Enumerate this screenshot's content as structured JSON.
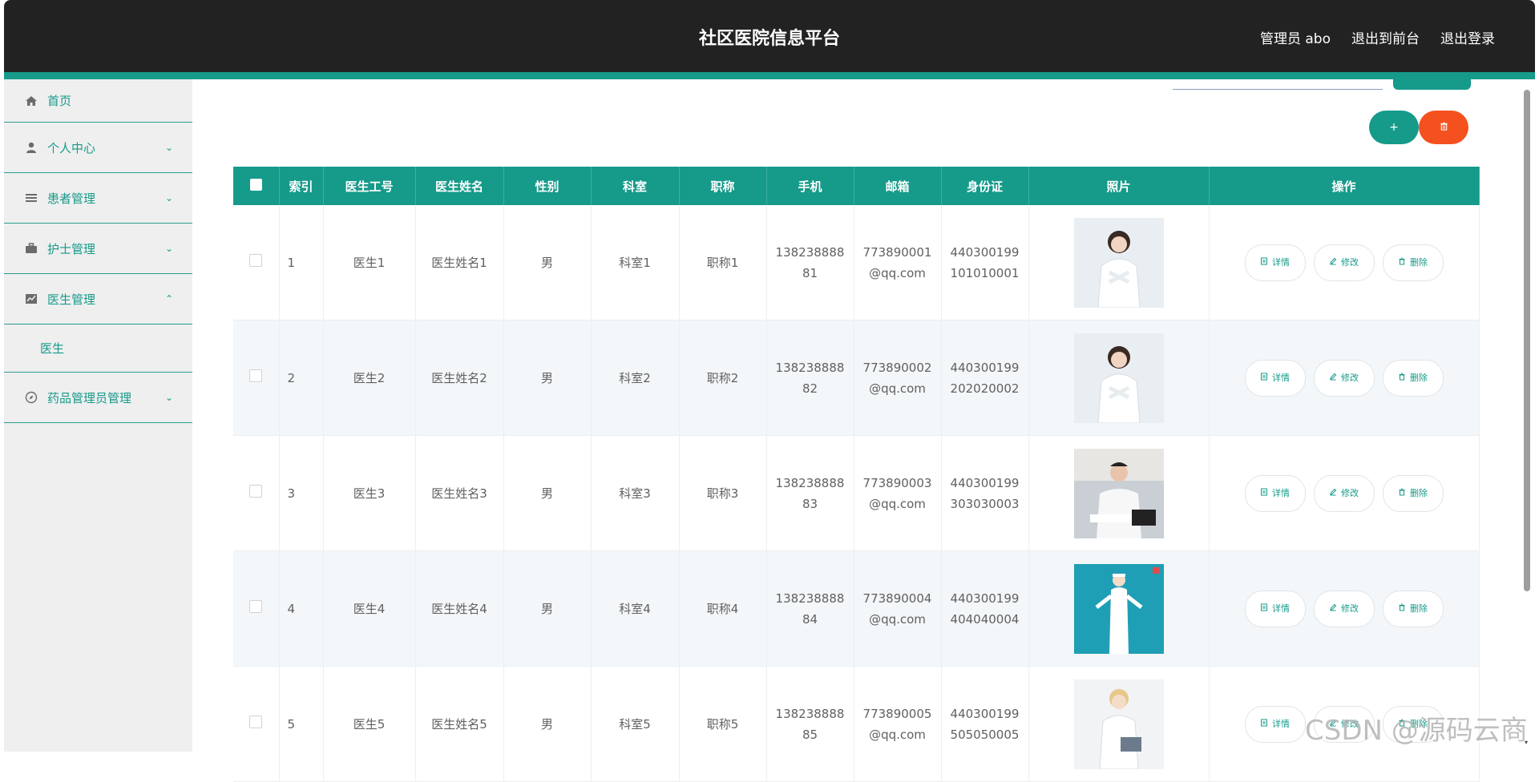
{
  "header": {
    "title": "社区医院信息平台",
    "user": "管理员 abo",
    "to_front": "退出到前台",
    "logout": "退出登录"
  },
  "sidebar": {
    "items": [
      {
        "label": "首页",
        "icon": "home-icon"
      },
      {
        "label": "个人中心",
        "icon": "user-icon",
        "expandable": true
      },
      {
        "label": "患者管理",
        "icon": "list-icon",
        "expandable": true
      },
      {
        "label": "护士管理",
        "icon": "briefcase-icon",
        "expandable": true
      },
      {
        "label": "医生管理",
        "icon": "chart-icon",
        "expanded": true
      },
      {
        "label": "药品管理员管理",
        "icon": "compass-icon",
        "expandable": true
      }
    ],
    "sub_item": "医生"
  },
  "toolbar": {
    "add_label": "+"
  },
  "table": {
    "headers": [
      "索引",
      "医生工号",
      "医生姓名",
      "性别",
      "科室",
      "职称",
      "手机",
      "邮箱",
      "身份证",
      "照片",
      "操作"
    ],
    "rows": [
      {
        "index": "1",
        "id": "医生1",
        "name": "医生姓名1",
        "gender": "男",
        "dept": "科室1",
        "title": "职称1",
        "phone1": "138238888",
        "phone2": "81",
        "email1": "773890001",
        "email2": "@qq.com",
        "idcard1": "440300199",
        "idcard2": "101010001",
        "photo": "female-doctor"
      },
      {
        "index": "2",
        "id": "医生2",
        "name": "医生姓名2",
        "gender": "男",
        "dept": "科室2",
        "title": "职称2",
        "phone1": "138238888",
        "phone2": "82",
        "email1": "773890002",
        "email2": "@qq.com",
        "idcard1": "440300199",
        "idcard2": "202020002",
        "photo": "female-doctor"
      },
      {
        "index": "3",
        "id": "医生3",
        "name": "医生姓名3",
        "gender": "男",
        "dept": "科室3",
        "title": "职称3",
        "phone1": "138238888",
        "phone2": "83",
        "email1": "773890003",
        "email2": "@qq.com",
        "idcard1": "440300199",
        "idcard2": "303030003",
        "photo": "male-doctor"
      },
      {
        "index": "4",
        "id": "医生4",
        "name": "医生姓名4",
        "gender": "男",
        "dept": "科室4",
        "title": "职称4",
        "phone1": "138238888",
        "phone2": "84",
        "email1": "773890004",
        "email2": "@qq.com",
        "idcard1": "440300199",
        "idcard2": "404040004",
        "photo": "nurse"
      },
      {
        "index": "5",
        "id": "医生5",
        "name": "医生姓名5",
        "gender": "男",
        "dept": "科室5",
        "title": "职称5",
        "phone1": "138238888",
        "phone2": "85",
        "email1": "773890005",
        "email2": "@qq.com",
        "idcard1": "440300199",
        "idcard2": "505050005",
        "photo": "female-doctor-2"
      }
    ],
    "ops": {
      "detail": "详情",
      "edit": "修改",
      "remove": "删除"
    }
  },
  "watermark": "CSDN @源码云商",
  "colors": {
    "header_bg": "#222222",
    "accent": "#169a8a",
    "danger": "#f4511e",
    "sidebar_bg": "#efefef"
  }
}
